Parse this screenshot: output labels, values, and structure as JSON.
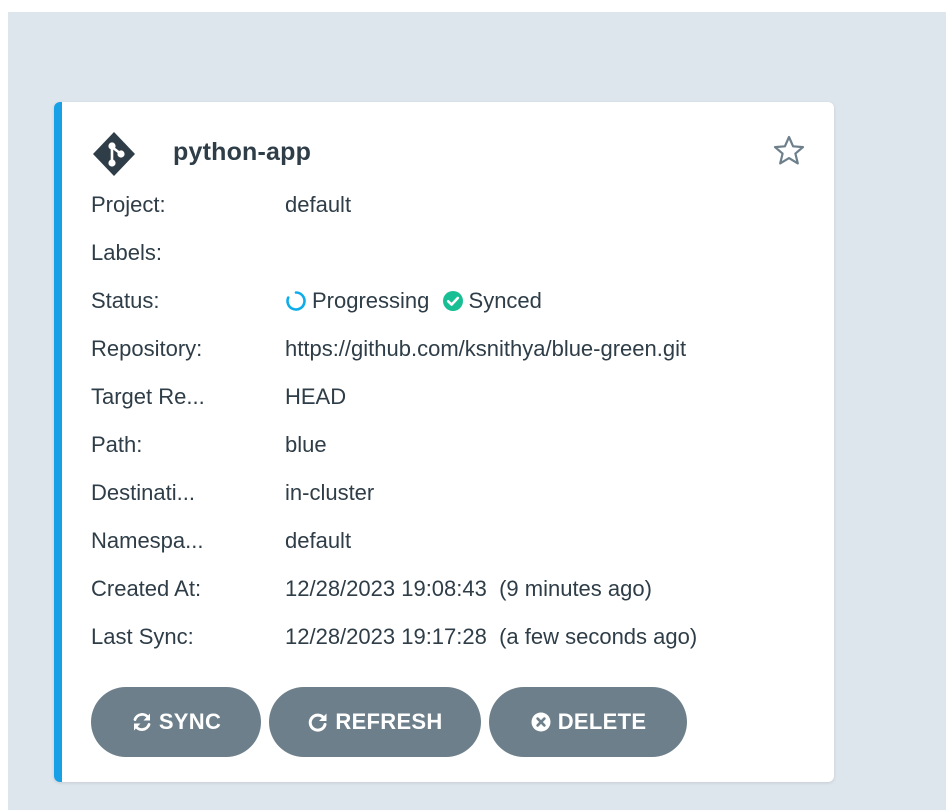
{
  "app": {
    "name": "python-app",
    "starred": false
  },
  "fields": {
    "project": {
      "label": "Project:",
      "value": "default"
    },
    "labels": {
      "label": "Labels:",
      "value": ""
    },
    "status": {
      "label": "Status:",
      "health": "Progressing",
      "sync": "Synced"
    },
    "repository": {
      "label": "Repository:",
      "value": "https://github.com/ksnithya/blue-green.git"
    },
    "target_revision": {
      "label": "Target Re...",
      "value": "HEAD"
    },
    "path": {
      "label": "Path:",
      "value": "blue"
    },
    "destination": {
      "label": "Destinati...",
      "value": "in-cluster"
    },
    "namespace": {
      "label": "Namespa...",
      "value": "default"
    },
    "created_at": {
      "label": "Created At:",
      "value": "12/28/2023 19:08:43  (9 minutes ago)"
    },
    "last_sync": {
      "label": "Last Sync:",
      "value": "12/28/2023 19:17:28  (a few seconds ago)"
    }
  },
  "actions": {
    "sync_label": "SYNC",
    "refresh_label": "REFRESH",
    "delete_label": "DELETE"
  },
  "icons": {
    "logo": "git-diamond-icon",
    "favorite": "star-outline-icon",
    "health": "progressing-spinner-icon",
    "sync": "check-circle-icon",
    "sync_button": "sync-arrows-icon",
    "refresh_button": "redo-icon",
    "delete_button": "times-circle-icon"
  },
  "colors": {
    "accent": "#18a0e6",
    "progressing": "#0dadea",
    "synced": "#18be94",
    "button_bg": "#6d7f8b",
    "text": "#2e3d47",
    "background": "#dee6ed"
  }
}
